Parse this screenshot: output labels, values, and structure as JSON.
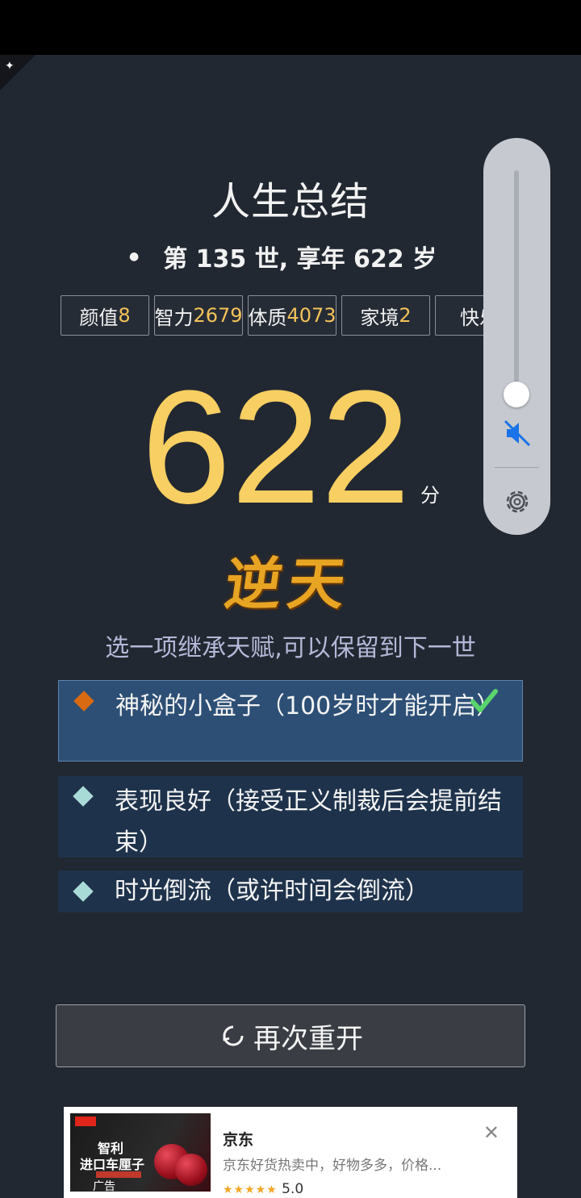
{
  "summary": {
    "title": "人生总结",
    "life_line": "第 135 世, 享年 622 岁"
  },
  "properties": [
    {
      "label": "颜值",
      "value": "8"
    },
    {
      "label": "智力",
      "value": "2679"
    },
    {
      "label": "体质",
      "value": "4073"
    },
    {
      "label": "家境",
      "value": "2"
    },
    {
      "label": "快乐",
      "value": ""
    }
  ],
  "score": {
    "value": "622",
    "unit": "分",
    "grade": "逆天"
  },
  "inherit": {
    "hint": "选一项继承天赋,可以保留到下一世",
    "talents": [
      {
        "text": "神秘的小盒子（100岁时才能开启）",
        "selected": true,
        "bullet_color": "#d96a12"
      },
      {
        "text": "表现良好（接受正义制裁后会提前结束）",
        "selected": false,
        "bullet_color": "#a9dbd6"
      },
      {
        "text": "时光倒流（或许时间会倒流）",
        "selected": false,
        "bullet_color": "#a9dbd6"
      }
    ]
  },
  "restart": {
    "label": "再次重开"
  },
  "ad": {
    "image_title": "智利",
    "image_subtitle": "进口车厘子",
    "image_label": "广告",
    "title": "京东",
    "description": "京东好货热卖中，好物多多，价格...",
    "rating": "5.0",
    "close_icon": "close-icon"
  },
  "volume": {
    "level": 0.0,
    "muted": true,
    "accent_color": "#1a73e8"
  },
  "colors": {
    "background": "#222831",
    "score": "#f7cf62",
    "property_value": "#f3c25a"
  }
}
